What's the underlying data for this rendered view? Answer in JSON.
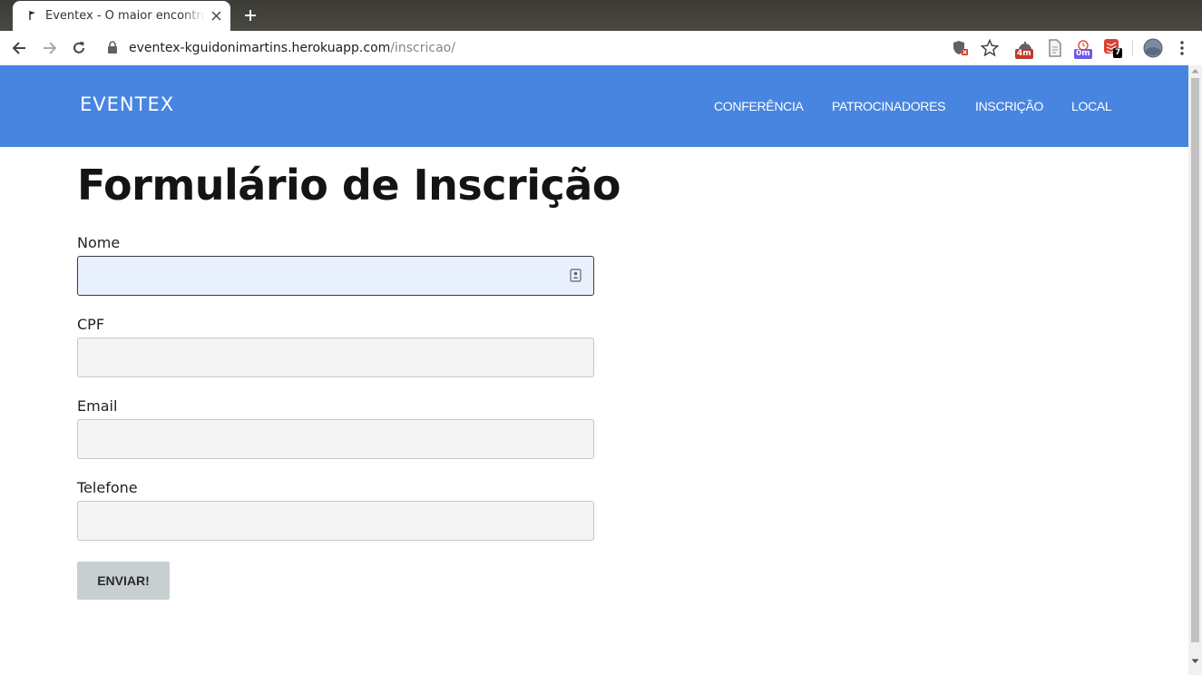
{
  "browser": {
    "tab_title": "Eventex - O maior encontro",
    "url_host": "eventex-kguidonimartins.herokuapp.com",
    "url_path": "/inscricao/",
    "extensions": [
      {
        "name": "ext-timer-1",
        "badge": "4m",
        "badge_color": "#c0392b"
      },
      {
        "name": "ext-page",
        "badge": ""
      },
      {
        "name": "ext-timer-2",
        "badge": "0m",
        "badge_color": "#6c5ce7"
      },
      {
        "name": "ext-todoist",
        "badge": "7",
        "badge_color": "#000000"
      }
    ]
  },
  "site": {
    "brand": "EVENTEX",
    "brand_color": "#4785e0",
    "nav": [
      {
        "label": "CONFERÊNCIA"
      },
      {
        "label": "PATROCINADORES"
      },
      {
        "label": "INSCRIÇÃO"
      },
      {
        "label": "LOCAL"
      }
    ]
  },
  "form": {
    "title": "Formulário de Inscrição",
    "fields": [
      {
        "label": "Nome",
        "value": "",
        "placeholder": ""
      },
      {
        "label": "CPF",
        "value": "",
        "placeholder": ""
      },
      {
        "label": "Email",
        "value": "",
        "placeholder": ""
      },
      {
        "label": "Telefone",
        "value": "",
        "placeholder": ""
      }
    ],
    "submit_label": "ENVIAR!"
  }
}
